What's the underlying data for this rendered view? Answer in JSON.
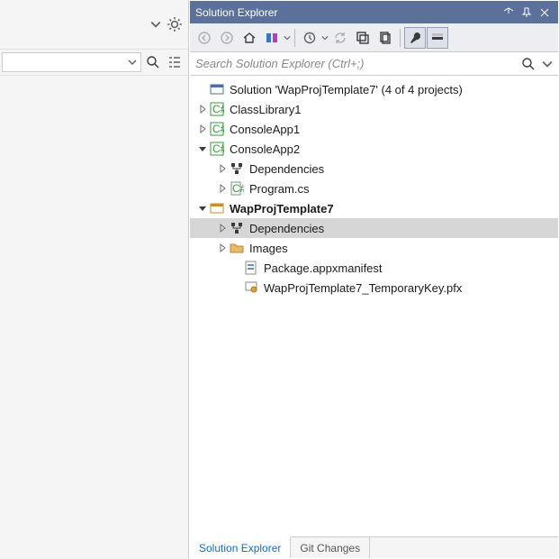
{
  "panel": {
    "title": "Solution Explorer",
    "search_placeholder": "Search Solution Explorer (Ctrl+;)"
  },
  "tree": {
    "solution": "Solution 'WapProjTemplate7' (4 of 4 projects)",
    "p1": "ClassLibrary1",
    "p2": "ConsoleApp1",
    "p3": "ConsoleApp2",
    "p3_dep": "Dependencies",
    "p3_file": "Program.cs",
    "p4": "WapProjTemplate7",
    "p4_dep": "Dependencies",
    "p4_img": "Images",
    "p4_manifest": "Package.appxmanifest",
    "p4_key": "WapProjTemplate7_TemporaryKey.pfx"
  },
  "tabs": {
    "sol": "Solution Explorer",
    "git": "Git Changes"
  }
}
